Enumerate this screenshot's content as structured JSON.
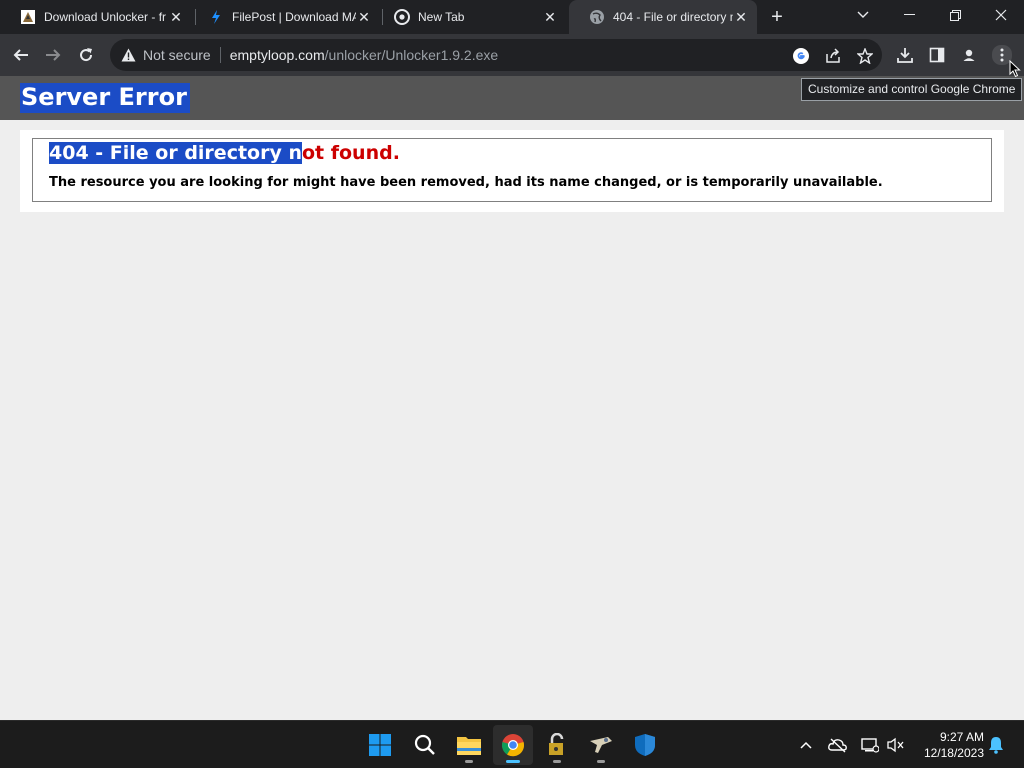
{
  "browser": {
    "tabs": [
      {
        "title": "Download Unlocker - fr",
        "icon": "unlocker-favicon",
        "active": false
      },
      {
        "title": "FilePost | Download MA",
        "icon": "filepost-bolt-favicon",
        "active": false
      },
      {
        "title": "New Tab",
        "icon": "chrome-favicon",
        "active": false
      },
      {
        "title": "404 - File or directory n",
        "icon": "globe-favicon",
        "active": true
      }
    ],
    "address_bar": {
      "security_label": "Not secure",
      "host": "emptyloop.com",
      "path": "/unlocker/Unlocker1.9.2.exe"
    },
    "tooltip": "Customize and control Google Chrome"
  },
  "page": {
    "header_title": "Server Error",
    "error_title_selected": "404 - File or directory n",
    "error_title_rest": "ot found.",
    "error_message": "The resource you are looking for might have been removed, had its name changed, or is temporarily unavailable.",
    "colors": {
      "header_bg": "#555555",
      "selection": "#1b4cc6",
      "error_red": "#cc0000",
      "page_bg": "#eeeeee"
    }
  },
  "taskbar": {
    "apps": [
      "start-icon",
      "search-icon",
      "file-explorer-icon",
      "chrome-icon",
      "unlocker-icon",
      "app-icon",
      "defender-icon"
    ],
    "clock": {
      "time": "9:27 AM",
      "date": "12/18/2023"
    }
  }
}
